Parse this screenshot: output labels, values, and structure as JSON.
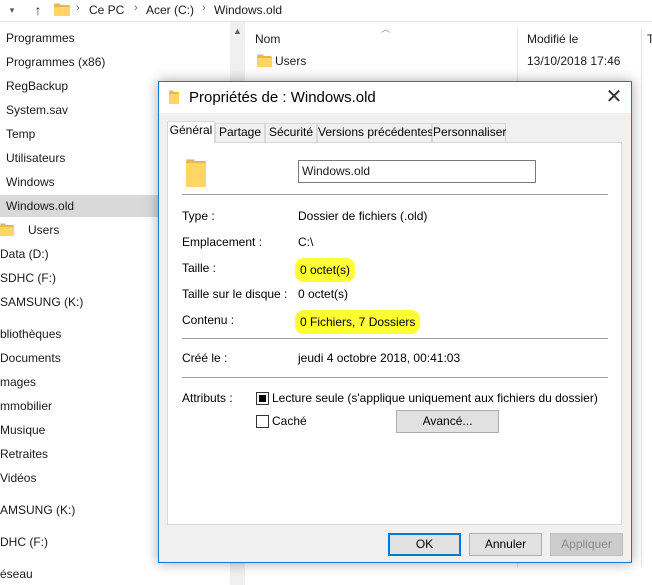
{
  "address_bar": {
    "crumbs": [
      "Ce PC",
      "Acer (C:)",
      "Windows.old"
    ]
  },
  "nav_pane": {
    "items": [
      {
        "label": "Programmes"
      },
      {
        "label": "Programmes (x86)"
      },
      {
        "label": "RegBackup"
      },
      {
        "label": "System.sav"
      },
      {
        "label": "Temp"
      },
      {
        "label": "Utilisateurs"
      },
      {
        "label": "Windows"
      },
      {
        "label": "Windows.old"
      },
      {
        "label": "Users"
      },
      {
        "label": "Data (D:)"
      },
      {
        "label": "SDHC (F:)"
      },
      {
        "label": "SAMSUNG  (K:)"
      },
      {
        "label": "bliothèques"
      },
      {
        "label": "Documents"
      },
      {
        "label": "mages"
      },
      {
        "label": "mmobilier"
      },
      {
        "label": "Musique"
      },
      {
        "label": "Retraites"
      },
      {
        "label": "Vidéos"
      },
      {
        "label": "AMSUNG  (K:)"
      },
      {
        "label": "DHC (F:)"
      },
      {
        "label": "éseau"
      }
    ]
  },
  "file_list": {
    "columns": [
      "Nom",
      "Modifié le",
      "T"
    ],
    "rows": [
      {
        "name": "Users",
        "modified": "13/10/2018 17:46"
      }
    ]
  },
  "dialog": {
    "title": "Propriétés de : Windows.old",
    "close_glyph": "✕",
    "tabs": [
      "Général",
      "Partage",
      "Sécurité",
      "Versions précédentes",
      "Personnaliser"
    ],
    "folder_name": "Windows.old",
    "properties": {
      "type_label": "Type :",
      "type_value": "Dossier de fichiers (.old)",
      "location_label": "Emplacement :",
      "location_value": "C:\\",
      "size_label": "Taille :",
      "size_value": "0 octet(s)",
      "size_on_disk_label": "Taille sur le disque :",
      "size_on_disk_value": "0 octet(s)",
      "contents_label": "Contenu :",
      "contents_value": "0 Fichiers, 7 Dossiers",
      "created_label": "Créé le :",
      "created_value": "jeudi 4 octobre 2018, 00:41:03",
      "attributes_label": "Attributs :"
    },
    "attributes": {
      "readonly_label": "Lecture seule (s'applique uniquement aux fichiers du dossier)",
      "readonly_checked": true,
      "hidden_label": "Caché",
      "hidden_checked": false,
      "advanced_button": "Avancé..."
    },
    "buttons": {
      "ok": "OK",
      "cancel": "Annuler",
      "apply": "Appliquer"
    },
    "highlight_color": "#ffff33",
    "border_color": "#1979ca"
  }
}
